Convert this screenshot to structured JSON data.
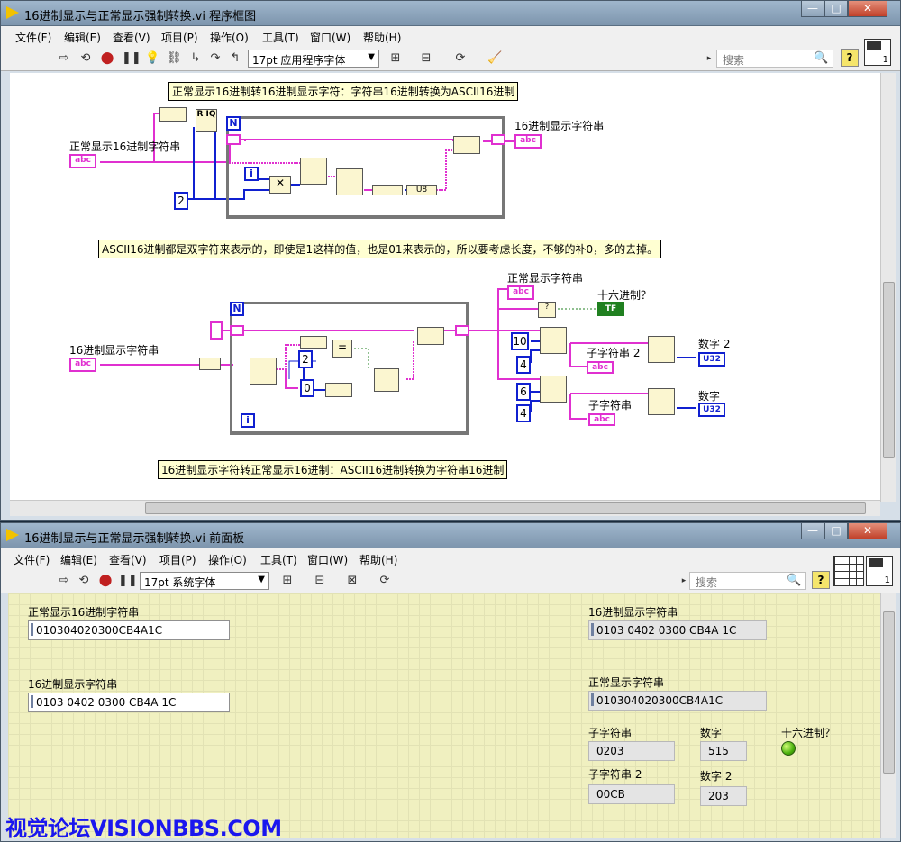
{
  "diagram_window": {
    "title": "16进制显示与正常显示强制转换.vi 程序框图",
    "menu": [
      "文件(F)",
      "编辑(E)",
      "查看(V)",
      "项目(P)",
      "操作(O)",
      "工具(T)",
      "窗口(W)",
      "帮助(H)"
    ],
    "font": "17pt 应用程序字体",
    "search_placeholder": "搜索",
    "icon_number": "1",
    "comments": {
      "top": "正常显示16进制转16进制显示字符：字符串16进制转换为ASCII16进制",
      "middle": "ASCII16进制都是双字符来表示的，即使是1这样的值，也是01来表示的，所以要考虑长度，不够的补0，多的去掉。",
      "bottom": "16进制显示字符转正常显示16进制：ASCII16进制转换为字符串16进制"
    },
    "labels": {
      "normal_hex_string": "正常显示16进制字符串",
      "hex_display_string_out": "16进制显示字符串",
      "hex_display_string_in": "16进制显示字符串",
      "normal_display_string": "正常显示字符串",
      "is_hex": "十六进制？",
      "substring2": "子字符串 2",
      "substring": "子字符串",
      "number2": "数字 2",
      "number": "数字"
    },
    "terminals": {
      "abc": "abc",
      "tf": "TF",
      "u32": "U32",
      "u8": "U8",
      "n": "N",
      "i": "i"
    },
    "constants": {
      "two_a": "2",
      "two_b": "2",
      "zero": "0",
      "ten": "10",
      "four_a": "4",
      "six": "6",
      "four_b": "4"
    }
  },
  "front_panel_window": {
    "title": "16进制显示与正常显示强制转换.vi 前面板",
    "menu": [
      "文件(F)",
      "编辑(E)",
      "查看(V)",
      "项目(P)",
      "操作(O)",
      "工具(T)",
      "窗口(W)",
      "帮助(H)"
    ],
    "font": "17pt 系统字体",
    "search_placeholder": "搜索",
    "icon_number": "1",
    "controls": {
      "normal_hex_string": {
        "label": "正常显示16进制字符串",
        "value": "010304020300CB4A1C"
      },
      "hex_display_string_in": {
        "label": "16进制显示字符串",
        "value": "0103 0402 0300 CB4A 1C"
      }
    },
    "indicators": {
      "hex_display_string": {
        "label": "16进制显示字符串",
        "value": "0103 0402 0300 CB4A 1C"
      },
      "normal_display_string": {
        "label": "正常显示字符串",
        "value": "010304020300CB4A1C"
      },
      "substring": {
        "label": "子字符串",
        "value": "0203"
      },
      "number": {
        "label": "数字",
        "value": "515"
      },
      "is_hex": {
        "label": "十六进制？"
      },
      "substring2": {
        "label": "子字符串 2",
        "value": "00CB"
      },
      "number2": {
        "label": "数字 2",
        "value": "203"
      }
    }
  },
  "watermark": "视觉论坛VISIONBBS.COM",
  "colors": {
    "string_wire": "#e030d0",
    "numeric_wire": "#1020d0",
    "bool_wire": "#208020",
    "panel_bg": "#f0f0c0"
  }
}
